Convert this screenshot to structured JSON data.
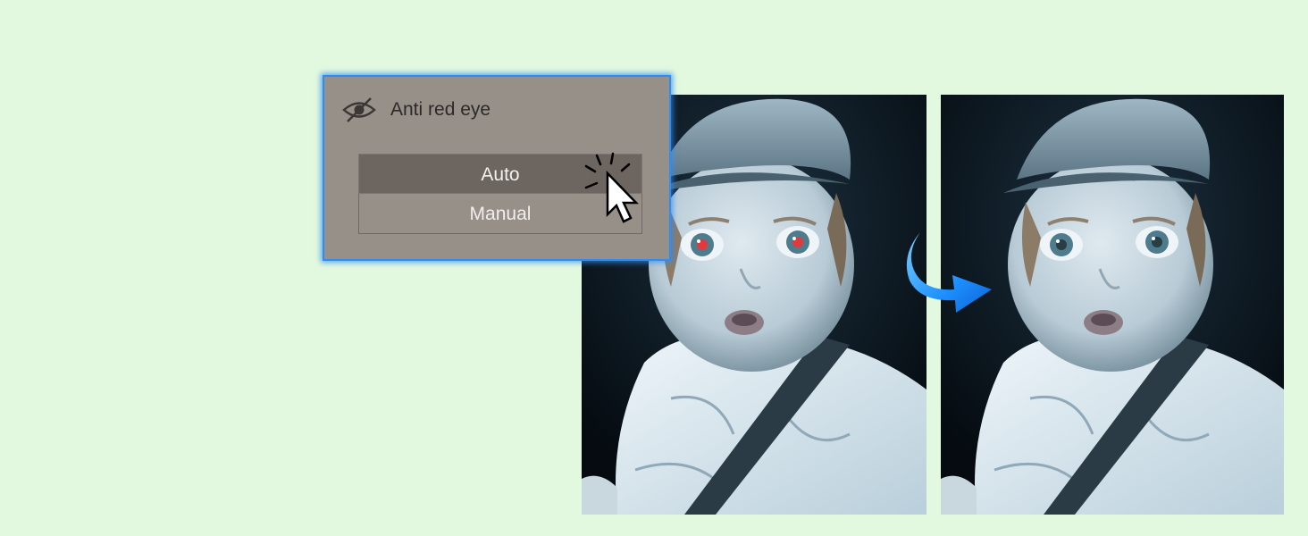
{
  "panel": {
    "title": "Anti red eye",
    "icon": "eye-off-icon",
    "options": [
      {
        "label": "Auto",
        "selected": true
      },
      {
        "label": "Manual",
        "selected": false
      }
    ]
  },
  "images": {
    "before": {
      "content": "photo of toddler in flat cap with red-eye effect"
    },
    "after": {
      "content": "same photo with red-eye removed"
    }
  },
  "colors": {
    "background": "#e2f9df",
    "panel_bg": "#979089",
    "panel_border": "#2f8cf6",
    "selected_option_bg": "#6c6560",
    "arrow": "#1e90ff"
  }
}
